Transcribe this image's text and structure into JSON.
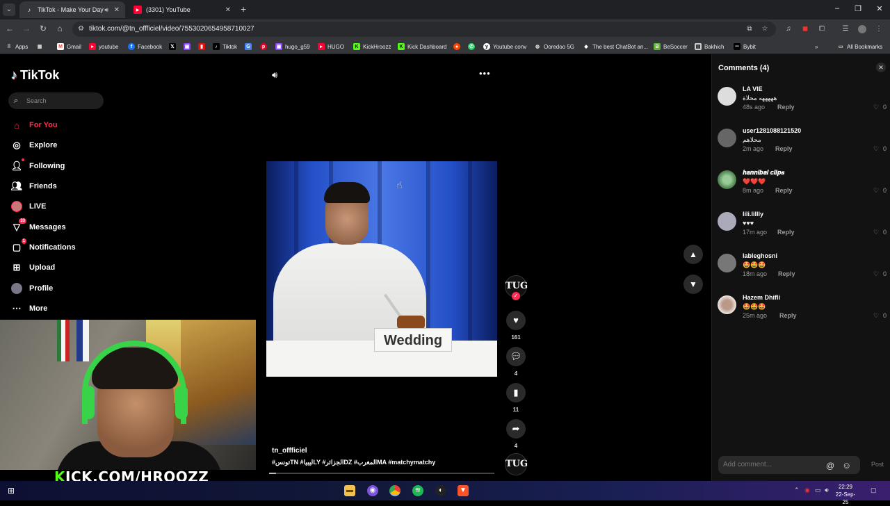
{
  "browser": {
    "tabs": [
      {
        "title": "TikTok - Make Your Day",
        "active": true
      },
      {
        "title": "(3301) YouTube",
        "active": false
      }
    ],
    "url": "tiktok.com/@tn_offficiel/video/7553020654958710027",
    "bookmarks": [
      "Apps",
      "Gmail",
      "youtube",
      "Facebook",
      "",
      "",
      "Tiktok",
      "",
      "",
      "hugo_g59",
      "HUGO",
      "KickHroozz",
      "Kick Dashboard",
      "",
      "",
      "Youtube conv",
      "Ooredoo 5G",
      "The best ChatBot an...",
      "BeSoccer",
      "Bakhich",
      "Bybit"
    ],
    "all_bookmarks": "All Bookmarks"
  },
  "tiktok": {
    "logo": "TikTok",
    "search_placeholder": "Search",
    "nav": [
      {
        "label": "For You",
        "icon": "home-icon"
      },
      {
        "label": "Explore",
        "icon": "compass-icon"
      },
      {
        "label": "Following",
        "icon": "following-icon"
      },
      {
        "label": "Friends",
        "icon": "friends-icon"
      },
      {
        "label": "LIVE",
        "icon": "live-icon"
      },
      {
        "label": "Messages",
        "icon": "messages-icon",
        "badge": "33"
      },
      {
        "label": "Notifications",
        "icon": "notifications-icon",
        "badge": "1"
      },
      {
        "label": "Upload",
        "icon": "upload-icon"
      },
      {
        "label": "Profile",
        "icon": "profile-icon"
      },
      {
        "label": "More",
        "icon": "more-icon"
      }
    ],
    "overlay_text": {
      "k": "K",
      "rest": "ICK.COM/HROOZZ"
    },
    "video": {
      "card_text": "Wedding",
      "author": "tn_offficiel",
      "tags": "#تونسTN #ليبياLY #الجزائرDZ #المغربMA #matchymatchy",
      "progress": 0.03
    },
    "actions": {
      "avatar_text": "TUG",
      "likes": "161",
      "comments": "4",
      "saves": "11",
      "shares": "4"
    },
    "comments_panel": {
      "title": "Comments (4)",
      "input_placeholder": "Add comment...",
      "post_label": "Post",
      "reply_label": "Reply",
      "items": [
        {
          "user": "LA VIE",
          "text": "هههههه محلاة",
          "time": "48s ago",
          "likes": "0"
        },
        {
          "user": "user1281088121520",
          "text": "محلاهم",
          "time": "2m ago",
          "likes": "0"
        },
        {
          "user": "𝒉𝒂𝒏𝒏𝒊𝒃𝒂𝒍 𝒄𝒍𝒊𝒑𝒔",
          "text": "❤️❤️❤️",
          "time": "8m ago",
          "likes": "0"
        },
        {
          "user": "lili.lillly",
          "text": "♥♥♥",
          "time": "17m ago",
          "likes": "0"
        },
        {
          "user": "lableghosni",
          "text": "🤩🤩🤩",
          "time": "18m ago",
          "likes": "0"
        },
        {
          "user": "Hazem Dhifli",
          "text": "🤩🤩🤩",
          "time": "25m ago",
          "likes": "0"
        }
      ]
    }
  },
  "taskbar": {
    "time": "22:29",
    "date": "22-Sep-25"
  }
}
